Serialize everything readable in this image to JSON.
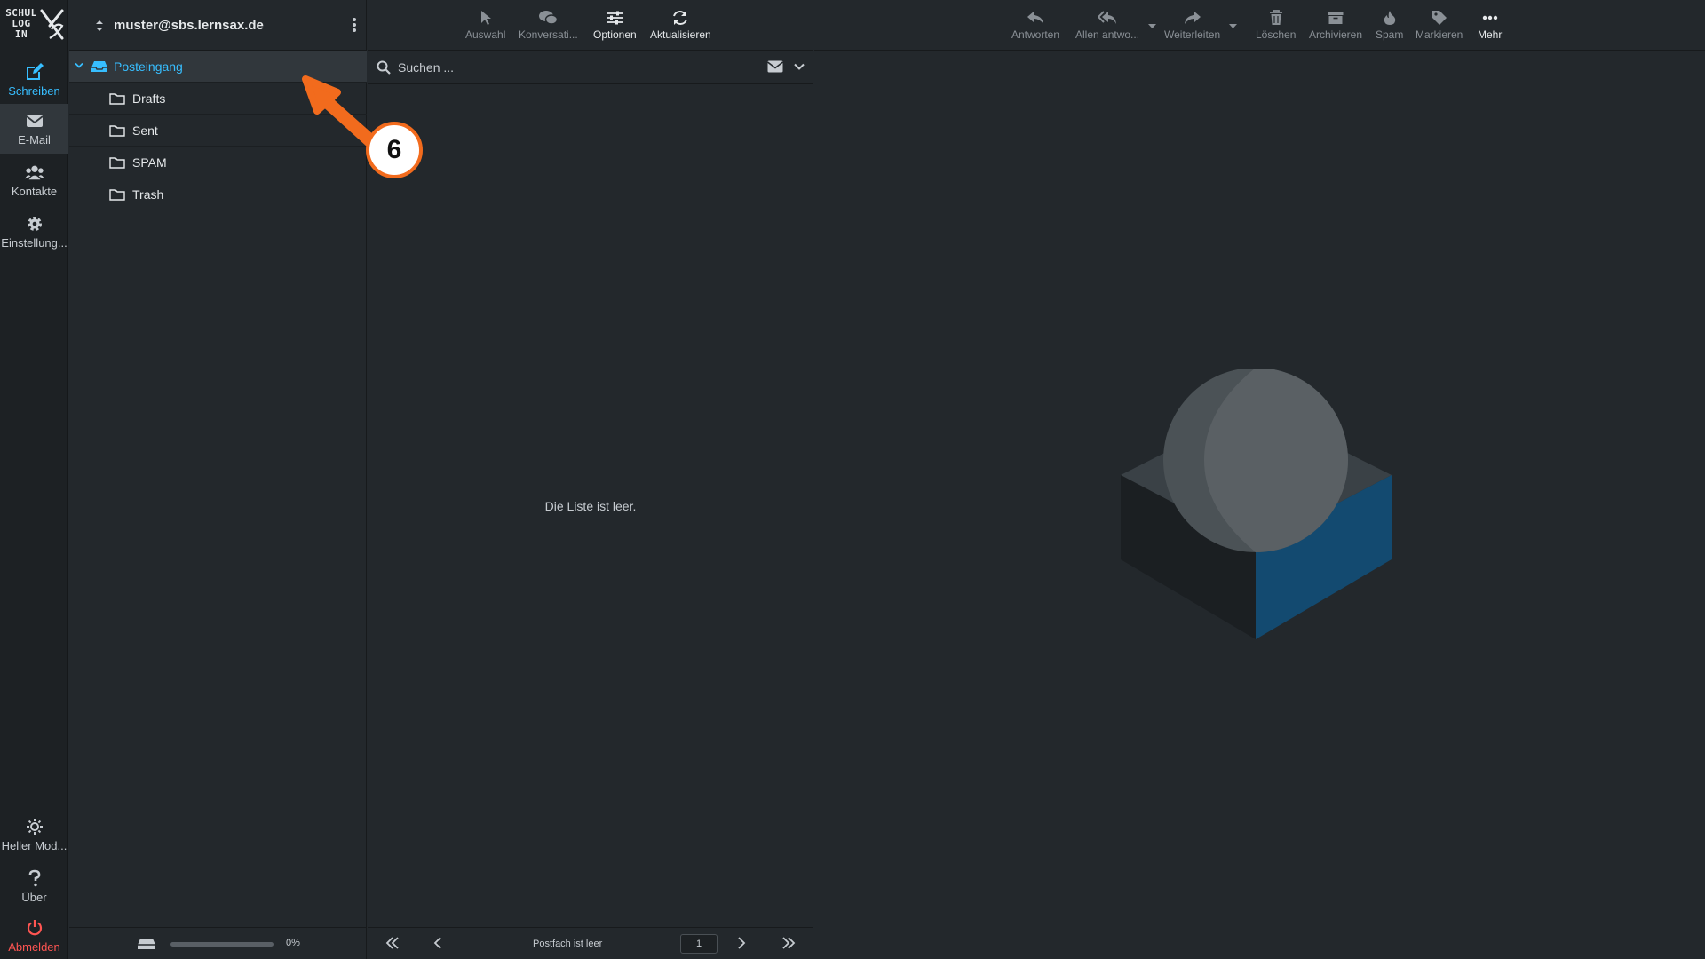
{
  "rail": {
    "logo_lines": [
      "SCHUL",
      "LOG",
      "IN"
    ],
    "compose": "Schreiben",
    "mail": "E-Mail",
    "contacts": "Kontakte",
    "settings": "Einstellung...",
    "light_mode": "Heller Mod...",
    "about": "Über",
    "logout": "Abmelden"
  },
  "account": {
    "email": "muster@sbs.lernsax.de"
  },
  "folders": [
    {
      "name": "Posteingang",
      "selected": true,
      "icon": "inbox-icon"
    },
    {
      "name": "Drafts",
      "icon": "folder-icon"
    },
    {
      "name": "Sent",
      "icon": "folder-icon"
    },
    {
      "name": "SPAM",
      "icon": "folder-icon"
    },
    {
      "name": "Trash",
      "icon": "folder-icon"
    }
  ],
  "quota": {
    "percent_label": "0%",
    "fraction": 0
  },
  "list_toolbar": {
    "select": "Auswahl",
    "threads": "Konversati...",
    "options": "Optionen",
    "refresh": "Aktualisieren"
  },
  "search": {
    "placeholder": "Suchen ..."
  },
  "list": {
    "empty_text": "Die Liste ist leer.",
    "footer_status": "Postfach ist leer",
    "page": "1"
  },
  "preview_toolbar": {
    "reply": "Antworten",
    "reply_all": "Allen antwo...",
    "forward": "Weiterleiten",
    "delete": "Löschen",
    "archive": "Archivieren",
    "spam": "Spam",
    "mark": "Markieren",
    "more": "Mehr"
  },
  "annotation": {
    "number": "6",
    "color": "#f26b1d"
  },
  "colors": {
    "accent": "#37beff",
    "danger": "#ff5552",
    "background": "#23282c"
  }
}
